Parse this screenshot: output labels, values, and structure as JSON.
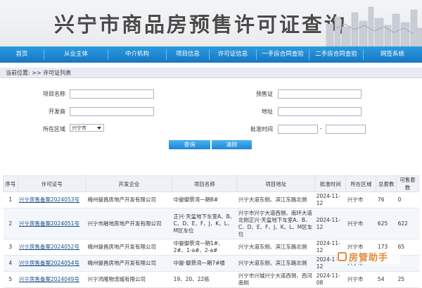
{
  "banner": {
    "title": "兴宁市商品房预售许可证查询"
  },
  "nav": [
    {
      "label": "首页"
    },
    {
      "label": "从业主体"
    },
    {
      "label": "中介机构"
    },
    {
      "label": "项目信息"
    },
    {
      "label": "许可证信息"
    },
    {
      "label": "一手房合同查验"
    },
    {
      "label": "二手房合同查验"
    },
    {
      "label": "网签系统"
    }
  ],
  "breadcrumb": "当前位置: >> 许可证列表",
  "form": {
    "project_name_label": "项目名称",
    "presale_cert_label": "预售证",
    "developer_label": "开发商",
    "address_label": "地址",
    "district_label": "所在区域",
    "district_value": "兴宁市",
    "approval_time_label": "批准时间",
    "dash": "-",
    "query_button": "查询",
    "clear_button": "清除"
  },
  "table": {
    "headers": [
      "序号",
      "许可证号",
      "开发企业",
      "项目名称",
      "项目地址",
      "批准时间",
      "所在区域",
      "总套数",
      "可售套数"
    ],
    "rows": [
      {
        "no": "1",
        "cert": "兴宁房售备案2024053号",
        "developer": "梅州骏昌房地产开发有限公司",
        "project": "中骏御景湾一期8#",
        "address": "兴宁大道东侧、滨江东路北侧",
        "date": "2024-11-12",
        "district": "兴宁市",
        "total": "76",
        "available": "0"
      },
      {
        "no": "2",
        "cert": "兴宁房售备案2024051号",
        "developer": "兴宁市融地房地产开发有限公司",
        "project": "正兴·天玺地下车室A、B、C、D、E、F、J、K、L、M区车位",
        "address": "兴宁市兴宁大道西侧、南环大道北侧正兴·天玺地下车室A、B、C、D、E、F、J、K、L、M区车位",
        "date": "2024-11-12",
        "district": "兴宁市",
        "total": "625",
        "available": "622"
      },
      {
        "no": "3",
        "cert": "兴宁房售备案2024052号",
        "developer": "梅州骏昌房地产开发有限公司",
        "project": "中骏御景湾一期1#、2#、1-a#、2-a#",
        "address": "兴宁大道东侧、滨江东路北侧",
        "date": "2024-11-12",
        "district": "兴宁市",
        "total": "173",
        "available": "65"
      },
      {
        "no": "4",
        "cert": "兴宁房售备案2024054号",
        "developer": "梅州骏昌房地产开发有限公司",
        "project": "中骏·御景湾一期7#楼",
        "address": "兴宁大道东侧、滨江东路北侧",
        "date": "2024-11-12",
        "district": "兴宁市",
        "total": "",
        "available": ""
      },
      {
        "no": "5",
        "cert": "兴宁房售备案2024049号",
        "developer": "兴宁鸿隆物流城有限公司",
        "project": "19、20、22栋",
        "address": "兴宁市兴城兴宁大道西侧、西河南侧",
        "date": "2024-11-08",
        "district": "兴宁市",
        "total": "54",
        "available": "25"
      }
    ]
  },
  "watermark": {
    "text": "房管助手"
  }
}
